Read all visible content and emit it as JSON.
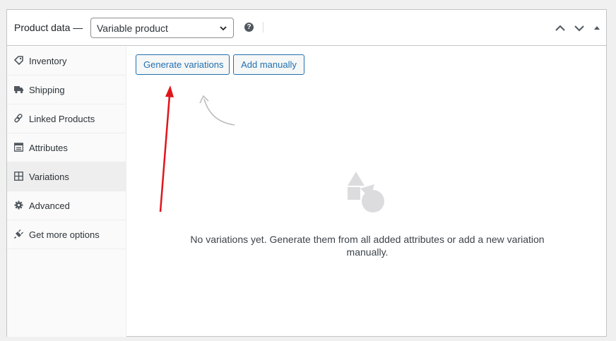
{
  "header": {
    "label": "Product data —",
    "product_type": "Variable product"
  },
  "sidebar": {
    "items": [
      {
        "label": "Inventory",
        "icon": "tag-icon"
      },
      {
        "label": "Shipping",
        "icon": "truck-icon"
      },
      {
        "label": "Linked Products",
        "icon": "link-icon"
      },
      {
        "label": "Attributes",
        "icon": "list-icon"
      },
      {
        "label": "Variations",
        "icon": "grid-icon",
        "active": true
      },
      {
        "label": "Advanced",
        "icon": "gear-icon"
      },
      {
        "label": "Get more options",
        "icon": "plugin-icon"
      }
    ]
  },
  "main": {
    "generate_label": "Generate variations",
    "add_manually_label": "Add manually",
    "empty_message": "No variations yet. Generate them from all added attributes or add a new variation manually."
  },
  "colors": {
    "accent": "#2271b1",
    "annotation": "#e0151b"
  }
}
